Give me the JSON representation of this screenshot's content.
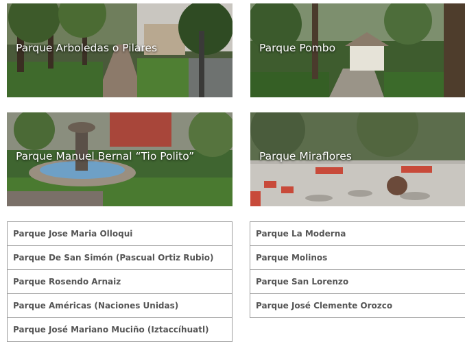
{
  "cards": [
    {
      "label": "Parque Arboledas o Pilares"
    },
    {
      "label": "Parque Pombo"
    },
    {
      "label": "Parque Manuel Bernal “Tio Polito”"
    },
    {
      "label": "Parque Miraflores"
    }
  ],
  "list_left": [
    "Parque Jose Maria Olloqui",
    "Parque De San Simón (Pascual Ortiz Rubio)",
    "Parque Rosendo Arnaiz",
    "Parque Américas (Naciones Unidas)",
    "Parque José Mariano Muciño (Iztaccíhuatl)"
  ],
  "list_right": [
    "Parque La Moderna",
    "Parque Molinos",
    "Parque San Lorenzo",
    "Parque José Clemente Orozco"
  ]
}
